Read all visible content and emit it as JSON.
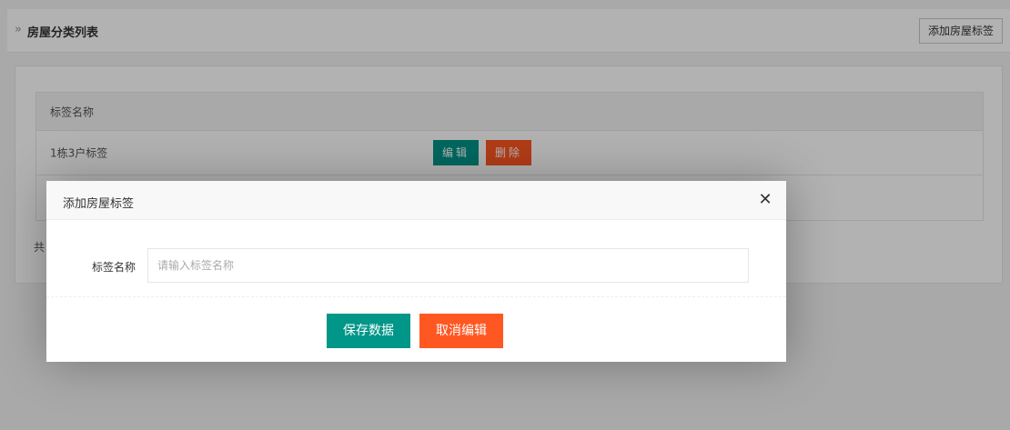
{
  "header": {
    "chevron": "»",
    "title": "房屋分类列表",
    "add_button": "添加房屋标签"
  },
  "table": {
    "column_header": "标签名称",
    "rows": [
      {
        "name": "1栋3户标签",
        "edit_label": "编辑",
        "delete_label": "删除"
      },
      {
        "name": ""
      }
    ]
  },
  "footer": {
    "total_prefix": "共"
  },
  "dialog": {
    "title": "添加房屋标签",
    "close_icon": "close-icon",
    "field_label": "标签名称",
    "field_value": "",
    "field_placeholder": "请输入标签名称",
    "save_label": "保存数据",
    "cancel_label": "取消编辑"
  },
  "colors": {
    "primary": "#009688",
    "danger": "#ff5722"
  }
}
